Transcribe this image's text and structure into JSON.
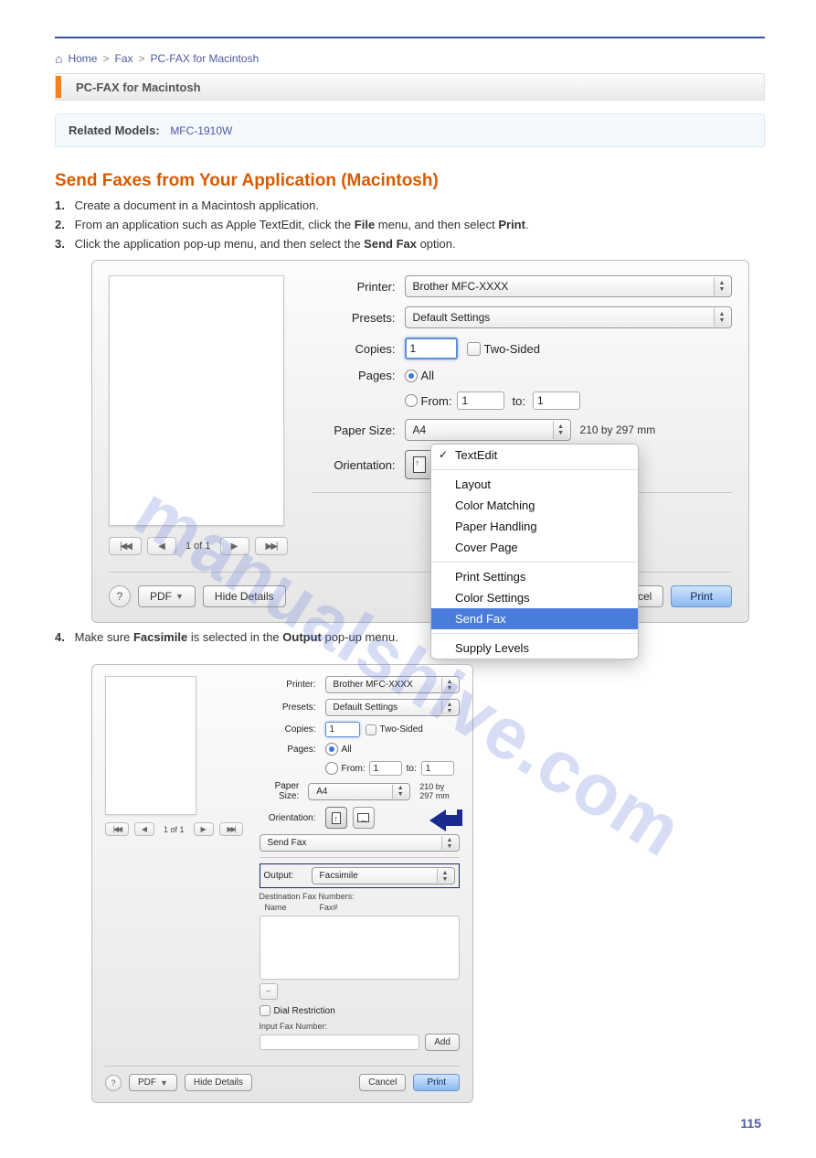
{
  "breadcrumb": {
    "sep": ">",
    "items": [
      "Home",
      "Fax",
      "PC-FAX for Macintosh"
    ]
  },
  "section_title": "PC-FAX for Macintosh",
  "related": {
    "label": "Related Models:",
    "model": "MFC-1910W"
  },
  "heading": "Send Faxes from Your Application (Macintosh)",
  "intro_step1_num": "1.",
  "intro_step1": "Create a document in a Macintosh application.",
  "intro_step2_num": "2.",
  "intro_step2_a": "From an application such as Apple TextEdit, click the ",
  "intro_step2_b": "File",
  "intro_step2_c": " menu, and then select ",
  "intro_step2_d": "Print",
  "intro_step2_e": ".",
  "intro_step3_num": "3.",
  "intro_step3_a": "Click the application pop-up menu, and then select the ",
  "intro_step3_b": "Send Fax",
  "intro_step3_c": " option.",
  "dialog1": {
    "printer_label": "Printer:",
    "printer_value": "Brother MFC-XXXX",
    "presets_label": "Presets:",
    "presets_value": "Default Settings",
    "copies_label": "Copies:",
    "copies_value": "1",
    "two_sided": "Two-Sided",
    "pages_label": "Pages:",
    "all": "All",
    "from": "From:",
    "from_val": "1",
    "to": "to:",
    "to_val": "1",
    "paper_label": "Paper Size:",
    "paper_value": "A4",
    "paper_dim": "210 by 297 mm",
    "orient_label": "Orientation:",
    "pager": "1 of 1",
    "help": "?",
    "pdf": "PDF",
    "hide": "Hide Details",
    "cancel": "Cancel",
    "print": "Print"
  },
  "menu": {
    "items_a": [
      "TextEdit"
    ],
    "items_b": [
      "Layout",
      "Color Matching",
      "Paper Handling",
      "Cover Page"
    ],
    "items_c": [
      "Print Settings",
      "Color Settings",
      "Send Fax"
    ],
    "items_d": [
      "Supply Levels"
    ]
  },
  "step4_num": "4.",
  "step4_a": "Make sure ",
  "step4_b": "Facsimile",
  "step4_c": " is selected in the ",
  "step4_d": "Output",
  "step4_e": " pop-up menu.",
  "dialog2": {
    "printer_value": "Brother MFC-XXXX",
    "presets_value": "Default Settings",
    "section_value": "Send Fax",
    "output_label": "Output:",
    "output_value": "Facsimile",
    "dest_label": "Destination Fax Numbers:",
    "col1": "Name",
    "col2": "Fax#",
    "dial_restrict": "Dial Restriction",
    "input_label": "Input Fax Number:",
    "add": "Add",
    "cancel": "Cancel",
    "print": "Print"
  },
  "watermark": "manualshive.com",
  "page_number": "115"
}
